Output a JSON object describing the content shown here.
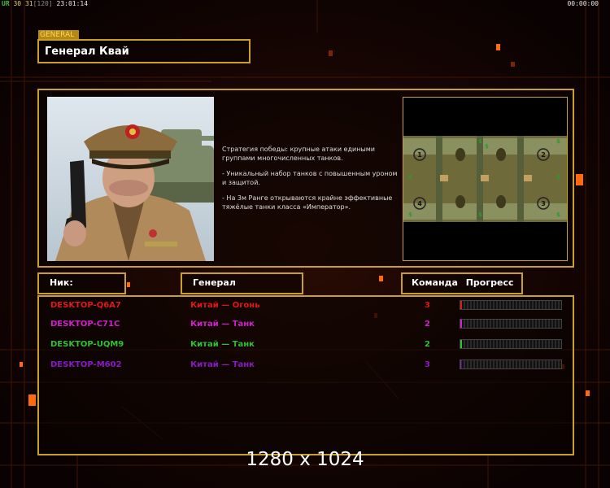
{
  "hud": {
    "ur_label": "UR",
    "fps": "30",
    "num2": "31",
    "paren": "[120]",
    "clock": "23:01:14",
    "timer": "00:00:00"
  },
  "general_tag": "GENERAL",
  "general_name": "Генерал Квай",
  "description": [
    "Стратегия победы: крупные атаки едиными группами многочисленных танков.",
    "- Уникальный набор танков с повышенным уроном и защитой.",
    "- На 3м Ранге открываются крайне эффективные тяжёлые танки класса «Император»."
  ],
  "headers": {
    "nick": "Ник:",
    "general": "Генерал",
    "team": "Команда",
    "progress": "Прогресс"
  },
  "players": [
    {
      "nick": "DESKTOP-Q6A7",
      "general": "Китай — Огонь",
      "team": "3",
      "progress": 0.02,
      "color": "#e01818"
    },
    {
      "nick": "DESKTOP-C71C",
      "general": "Китай — Танк",
      "team": "2",
      "progress": 0.01,
      "color": "#d21fcf"
    },
    {
      "nick": "DESKTOP-UQM9",
      "general": "Китай — Танк",
      "team": "2",
      "progress": 0.01,
      "color": "#30c030"
    },
    {
      "nick": "DESKTOP-M602",
      "general": "Китай — Танк",
      "team": "3",
      "progress": 0.0,
      "color": "#8a18c8"
    }
  ],
  "map_slots": [
    "1",
    "2",
    "4",
    "3"
  ],
  "resolution": "1280 x 1024",
  "colors": {
    "border_gold": "#c9a12a",
    "accent_orange": "#ff6a00"
  }
}
